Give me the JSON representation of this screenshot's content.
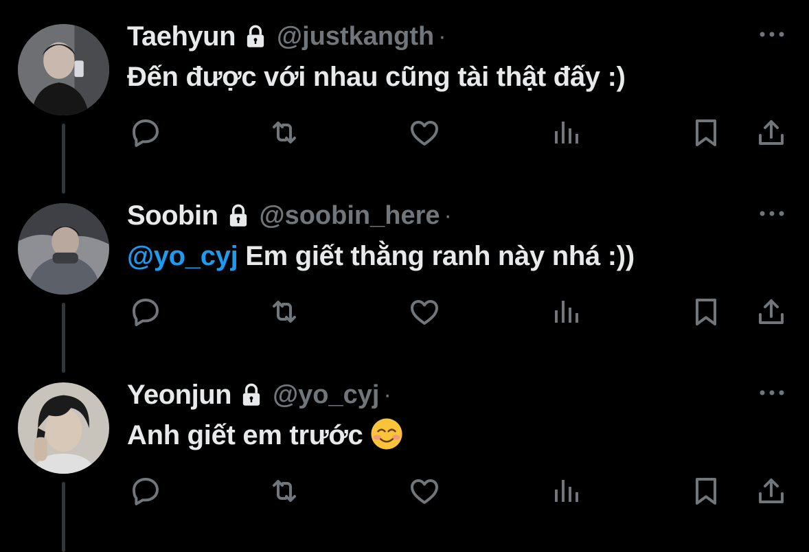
{
  "colors": {
    "background": "#000000",
    "text": "#e7e9ea",
    "muted": "#71767b",
    "mention": "#1d9bf0"
  },
  "tweets": [
    {
      "name": "Taehyun",
      "handle": "@justkangth",
      "separator": "·",
      "mention": "",
      "text": "Đến được với nhau cũng tài thật đấy :)",
      "emoji": "",
      "icons": [
        "lock-icon",
        "more-icon",
        "reply-icon",
        "retweet-icon",
        "like-icon",
        "views-icon",
        "bookmark-icon",
        "share-icon"
      ]
    },
    {
      "name": "Soobin",
      "handle": "@soobin_here",
      "separator": "·",
      "mention": "@yo_cyj",
      "text": " Em giết thằng ranh này nhá :))",
      "emoji": "",
      "icons": [
        "lock-icon",
        "more-icon",
        "reply-icon",
        "retweet-icon",
        "like-icon",
        "views-icon",
        "bookmark-icon",
        "share-icon"
      ]
    },
    {
      "name": "Yeonjun",
      "handle": "@yo_cyj",
      "separator": "·",
      "mention": "",
      "text": "Anh giết em trước",
      "emoji": "smiling-face-icon",
      "icons": [
        "lock-icon",
        "more-icon",
        "reply-icon",
        "retweet-icon",
        "like-icon",
        "views-icon",
        "bookmark-icon",
        "share-icon"
      ]
    }
  ]
}
